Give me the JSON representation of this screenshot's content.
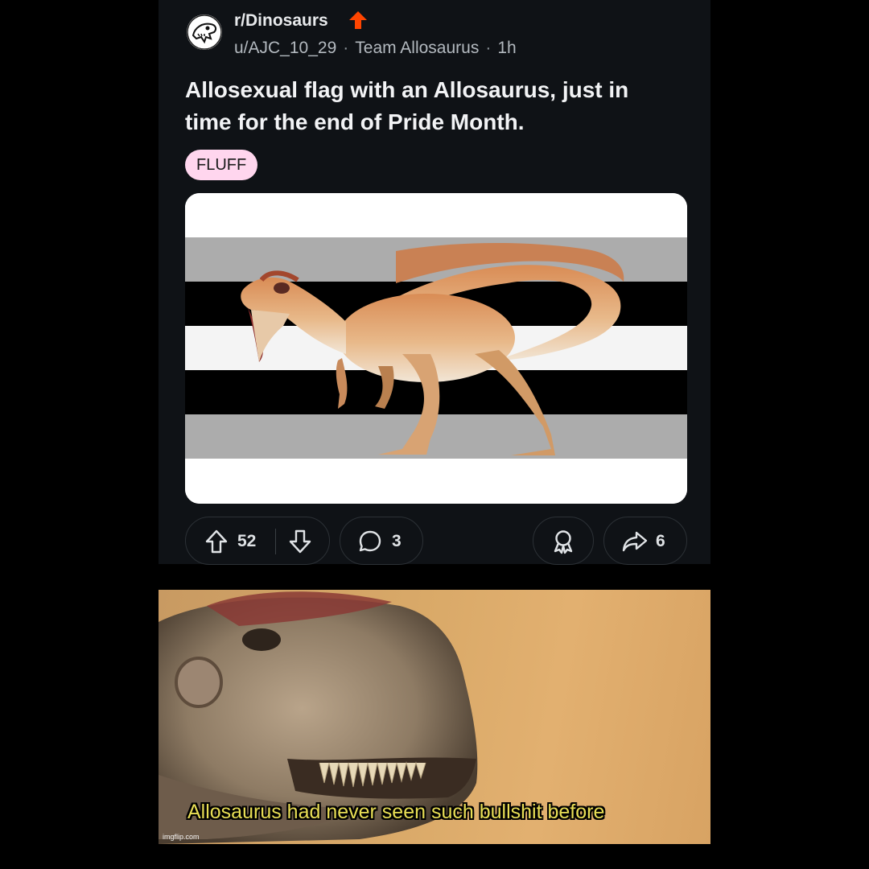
{
  "post": {
    "subreddit": "r/Dinosaurs",
    "author": "u/AJC_10_29",
    "user_flair": "Team Allosaurus",
    "time_ago": "1h",
    "title": "Allosexual flag with an Allosaurus, just in time for the end of Pride Month.",
    "post_flair": "FLUFF",
    "flag_stripes": [
      "#ffffff",
      "#acacac",
      "#000000",
      "#f4f4f4",
      "#000000",
      "#acacac",
      "#ffffff"
    ]
  },
  "actions": {
    "upvotes": "52",
    "comments": "3",
    "shares": "6"
  },
  "icons": {
    "subreddit_avatar": "dinosaur-skull-icon",
    "badge": "orange-up-arrow-icon",
    "upvote": "arrow-up-outline-icon",
    "downvote": "arrow-down-outline-icon",
    "comment": "speech-bubble-icon",
    "award": "award-ribbon-icon",
    "share": "share-arrow-icon"
  },
  "meme": {
    "caption": "Allosaurus had never seen such bullshit before",
    "watermark": "imgflip.com"
  },
  "colors": {
    "background": "#000000",
    "card": "#0f1216",
    "flair_bg": "#ffd6ee",
    "accent_orange": "#ff4500",
    "caption": "#e8de55"
  }
}
